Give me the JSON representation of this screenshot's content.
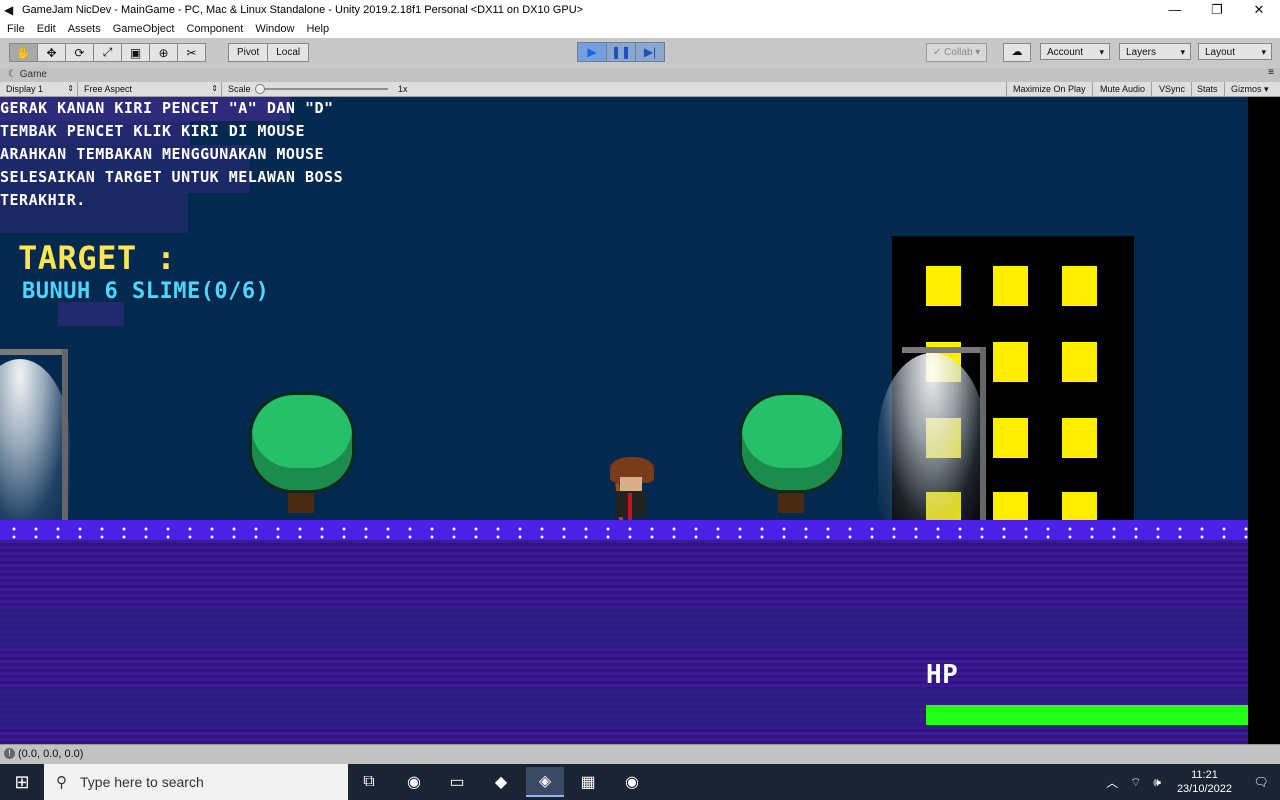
{
  "window": {
    "title": "GameJam NicDev - MainGame - PC, Mac & Linux Standalone - Unity 2019.2.18f1 Personal <DX11 on DX10 GPU>",
    "controls": [
      "—",
      "❐",
      "✕"
    ]
  },
  "menu": [
    "File",
    "Edit",
    "Assets",
    "GameObject",
    "Component",
    "Window",
    "Help"
  ],
  "toolbar": {
    "tools": [
      "✋",
      "✥",
      "⟳",
      "⤢",
      "▣",
      "⊕",
      "✂"
    ],
    "pivot_label": "Pivot",
    "local_label": "Local",
    "play_buttons": [
      "▶",
      "❚❚",
      "▶|"
    ],
    "collab_label": "✓ Collab ▾",
    "cloud_icon": "☁",
    "account_label": "Account",
    "layers_label": "Layers",
    "layout_label": "Layout"
  },
  "game_tab": {
    "label": "☾ Game",
    "display": "Display 1",
    "aspect": "Free Aspect",
    "scale_label": "Scale",
    "scale_value": "1x",
    "maximize": "Maximize On Play",
    "mute": "Mute Audio",
    "vsync": "VSync",
    "stats": "Stats",
    "gizmos": "Gizmos ▾"
  },
  "game": {
    "instructions": [
      "GERAK KANAN KIRI PENCET \"A\" DAN \"D\"",
      "TEMBAK PENCET KLIK KIRI DI MOUSE",
      "ARAHKAN TEMBAKAN MENGGUNAKAN MOUSE",
      "SELESAIKAN TARGET UNTUK MELAWAN BOSS",
      "TERAKHIR."
    ],
    "target_title": "TARGET :",
    "target_desc": "BUNUH 6 SLIME(0/6)",
    "hp_label": "HP",
    "hp_fraction": 1.0
  },
  "status": {
    "message": "(0.0, 0.0, 0.0)"
  },
  "taskbar": {
    "search_placeholder": "Type here to search",
    "time": "11:21",
    "date": "23/10/2022"
  },
  "colors": {
    "sky": "#04294e",
    "ground": "#3c1a95",
    "ground_line": "#4b21e8",
    "target_title": "#ffe650",
    "target_desc": "#4fd6ff",
    "hp_fill": "#22ff18",
    "window_light": "#ffee00"
  }
}
